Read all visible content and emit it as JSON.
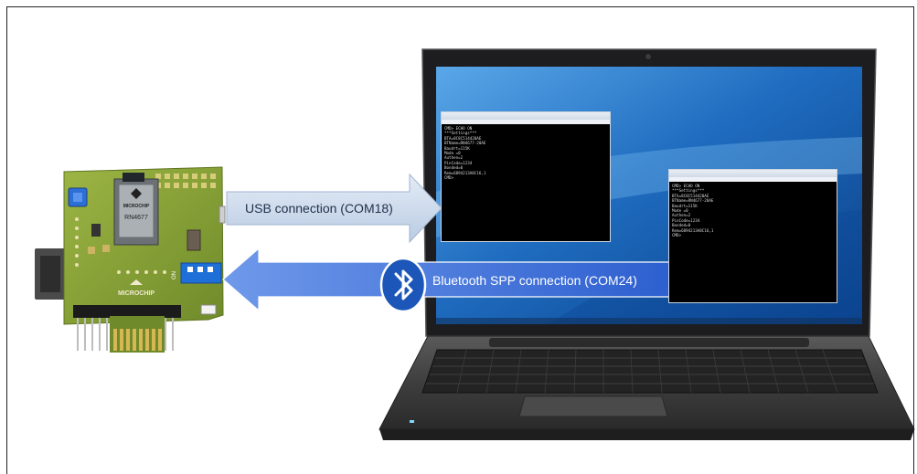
{
  "diagram": {
    "usb_connection_label": "USB connection (COM18)",
    "bluetooth_connection_label": "Bluetooth SPP connection (COM24)"
  },
  "board": {
    "logo_text": "MICROCHIP",
    "module_label": "RN4677",
    "dip_switch_label": "ON"
  },
  "terminal_windows": [
    {
      "lines": [
        "CMD> ECHO ON",
        "***Settings***",
        "BTA=8C8C514420AE",
        "BTName=RN4677-20AE",
        "Baudrt=115K",
        "Mode =0",
        "Authen=2",
        "PinCode=1234",
        "Bonded=0",
        "Rem=6894213A8C16,1",
        "CMD>"
      ]
    },
    {
      "lines": [
        "CMD> ECHO ON",
        "***Settings***",
        "BTA=8C8C514420AE",
        "BTName=RN4677-20AE",
        "Baudrt=115K",
        "Mode =0",
        "Authen=2",
        "PinCode=1234",
        "Bonded=0",
        "Rem=6894213A8C16,1",
        "CMD>"
      ]
    }
  ],
  "colors": {
    "usb_arrow": "#c9d7ea",
    "bt_arrow": "#3d6fd8",
    "bt_badge": "#1b56b8",
    "board_pcb": "#8aa437",
    "laptop_body": "#3a3a3a",
    "screen_blue": "#2a6fc4"
  }
}
